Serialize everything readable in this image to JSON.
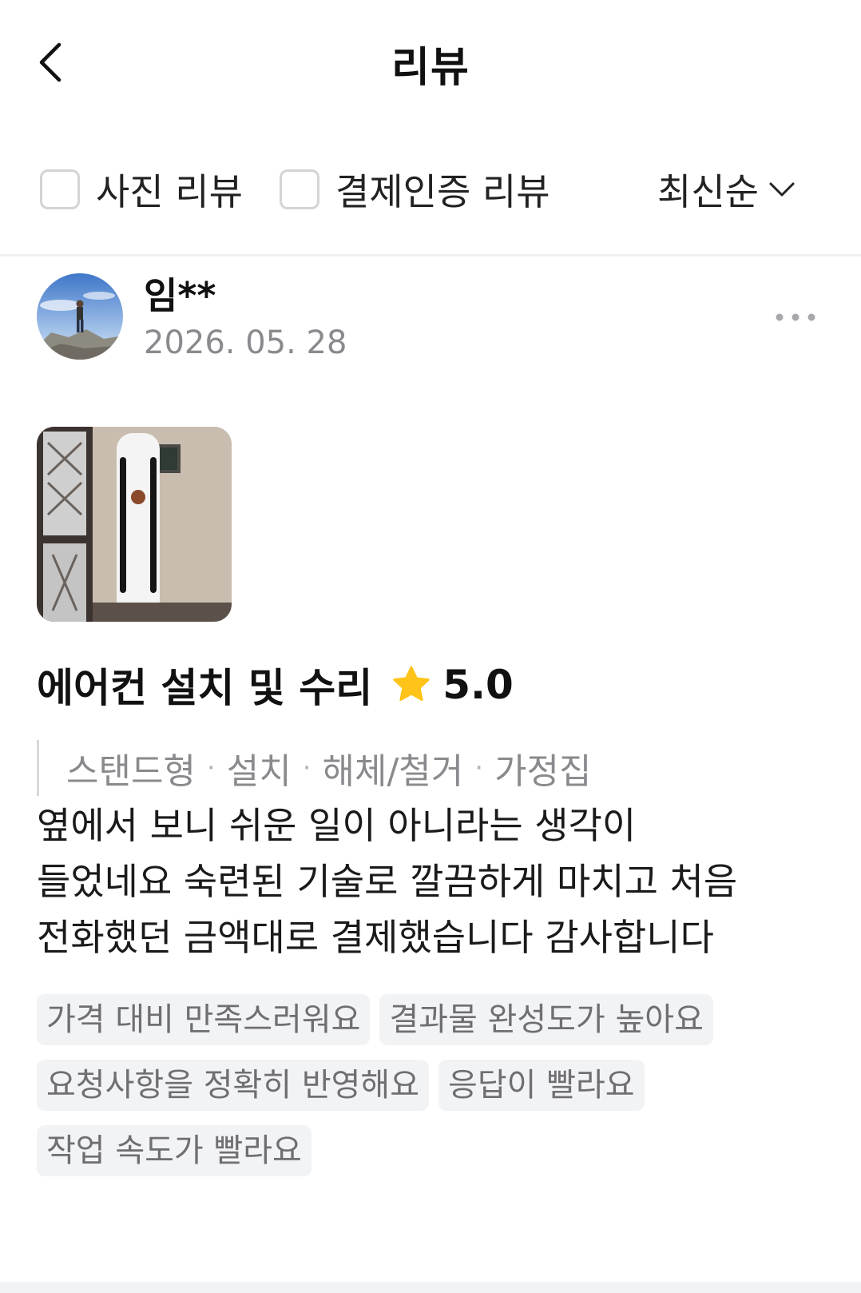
{
  "header": {
    "title": "리뷰",
    "back_icon": "chevron-left-icon"
  },
  "filters": {
    "photo_review": {
      "label": "사진 리뷰",
      "checked": false
    },
    "verified_review": {
      "label": "결제인증 리뷰",
      "checked": false
    },
    "sort": {
      "label": "최신순",
      "icon": "chevron-down-icon"
    }
  },
  "review": {
    "author": "임**",
    "date": "2026. 05. 28",
    "more_icon": "more-horizontal-icon",
    "service": "에어컨 설치 및 수리",
    "rating": "5.0",
    "rating_color": "#FFC31A",
    "options": [
      "스탠드형",
      "설치",
      "해체/철거",
      "가정집"
    ],
    "body_lines": [
      "옆에서 보니 쉬운 일이 아니라는 생각이",
      "들었네요 숙련된 기술로 깔끔하게 마치고 처음",
      "전화했던 금액대로 결제했습니다 감사합니다"
    ],
    "tags": [
      "가격 대비 만족스러워요",
      "결과물 완성도가 높아요",
      "요청사항을 정확히 반영해요",
      "응답이 빨라요",
      "작업 속도가 빨라요"
    ]
  }
}
